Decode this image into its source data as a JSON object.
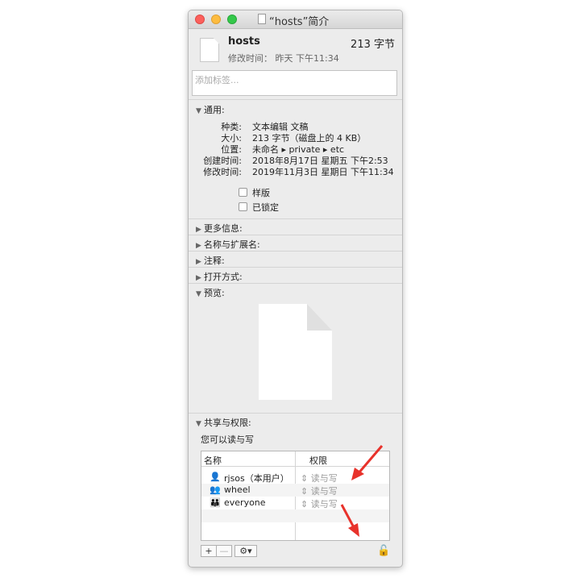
{
  "window": {
    "title": "“hosts”简介"
  },
  "header": {
    "name": "hosts",
    "size": "213 字节",
    "modified": "修改时间：  昨天 下午11:34"
  },
  "tags": {
    "placeholder": "添加标签..."
  },
  "general": {
    "title": "通用:",
    "rows": [
      {
        "label": "种类:",
        "value": "文本编辑 文稿"
      },
      {
        "label": "大小:",
        "value": "213 字节（磁盘上的 4 KB）"
      },
      {
        "label": "位置:",
        "value": "未命名 ▸ private ▸ etc"
      },
      {
        "label": "创建时间:",
        "value": "2018年8月17日 星期五 下午2:53"
      },
      {
        "label": "修改时间:",
        "value": "2019年11月3日 星期日 下午11:34"
      }
    ],
    "stationery": "样版",
    "locked": "已锁定"
  },
  "sections": {
    "more_info": "更多信息:",
    "name_ext": "名称与扩展名:",
    "comments": "注释:",
    "open_with": "打开方式:",
    "preview": "预览:",
    "sharing": "共享与权限:"
  },
  "sharing": {
    "status": "您可以读与写",
    "col_name": "名称",
    "col_priv": "权限",
    "rows": [
      {
        "user": "rjsos（本用户）",
        "priv": "读与写"
      },
      {
        "user": "wheel",
        "priv": "读与写"
      },
      {
        "user": "everyone",
        "priv": "读与写"
      }
    ]
  },
  "colors": {
    "accent_arrow": "#e8322b"
  }
}
